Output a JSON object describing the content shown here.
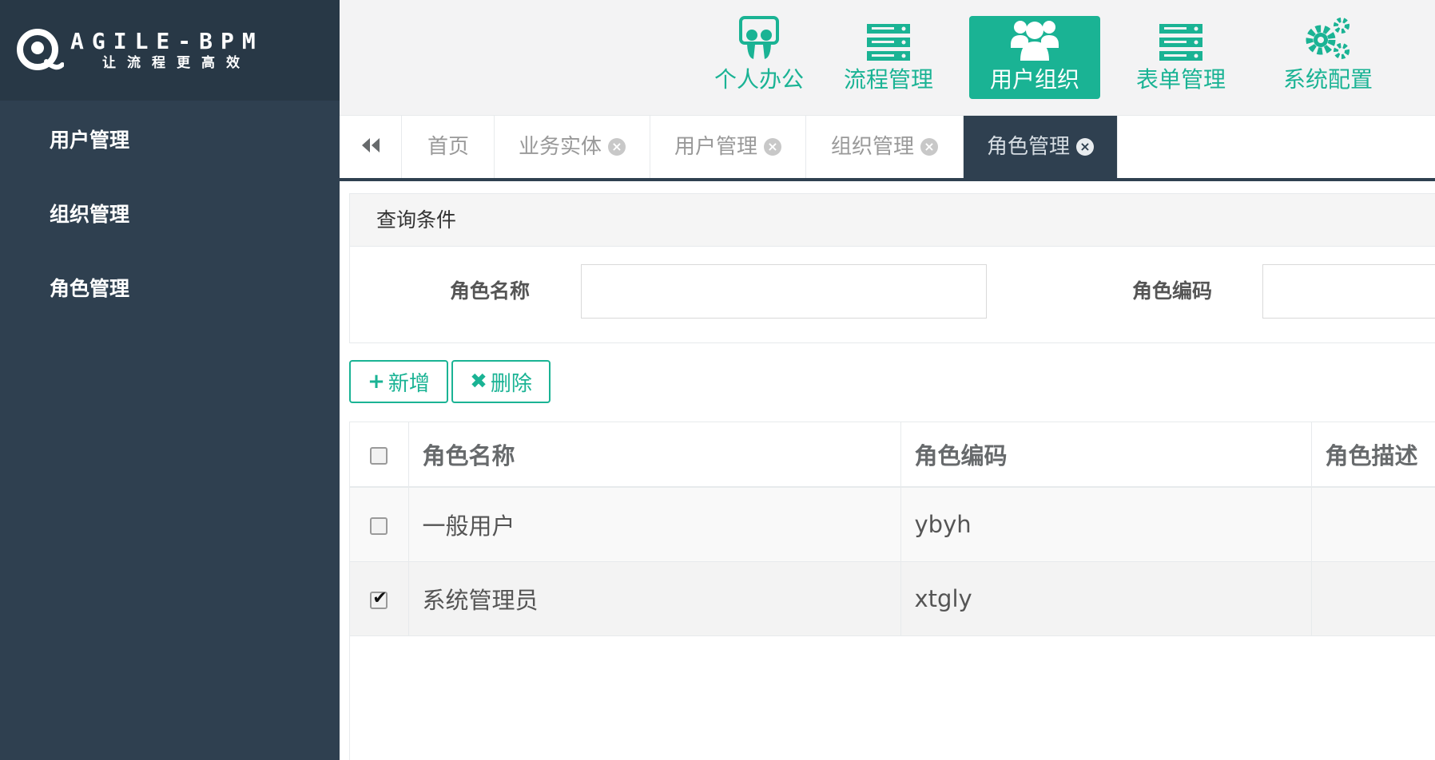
{
  "logo": {
    "title": "AGILE-BPM",
    "subtitle": "让流程更高效"
  },
  "sidebar": {
    "items": [
      {
        "label": "用户管理"
      },
      {
        "label": "组织管理"
      },
      {
        "label": "角色管理"
      }
    ]
  },
  "topnav": {
    "items": [
      {
        "label": "个人办公",
        "icon": "slideshare-icon"
      },
      {
        "label": "流程管理",
        "icon": "server-icon"
      },
      {
        "label": "用户组织",
        "icon": "users-icon",
        "active": true
      },
      {
        "label": "表单管理",
        "icon": "server-icon"
      },
      {
        "label": "系统配置",
        "icon": "gears-icon"
      }
    ],
    "accent": "#1ab394"
  },
  "tabs": {
    "back_icon": "double-left-icon",
    "items": [
      {
        "label": "首页"
      },
      {
        "label": "业务实体"
      },
      {
        "label": "用户管理"
      },
      {
        "label": "组织管理"
      },
      {
        "label": "角色管理",
        "active": true
      }
    ]
  },
  "query": {
    "title": "查询条件",
    "role_name_label": "角色名称",
    "role_code_label": "角色编码",
    "role_name_value": "",
    "role_code_value": ""
  },
  "toolbar": {
    "add_label": "新增",
    "delete_label": "删除"
  },
  "table": {
    "headers": [
      "角色名称",
      "角色编码",
      "角色描述"
    ],
    "rows": [
      {
        "name": "一般用户",
        "code": "ybyh",
        "desc": "",
        "checked": false
      },
      {
        "name": "系统管理员",
        "code": "xtgly",
        "desc": "",
        "checked": true
      }
    ]
  },
  "colors": {
    "sidebar": "#2f4050",
    "accent": "#1ab394"
  }
}
